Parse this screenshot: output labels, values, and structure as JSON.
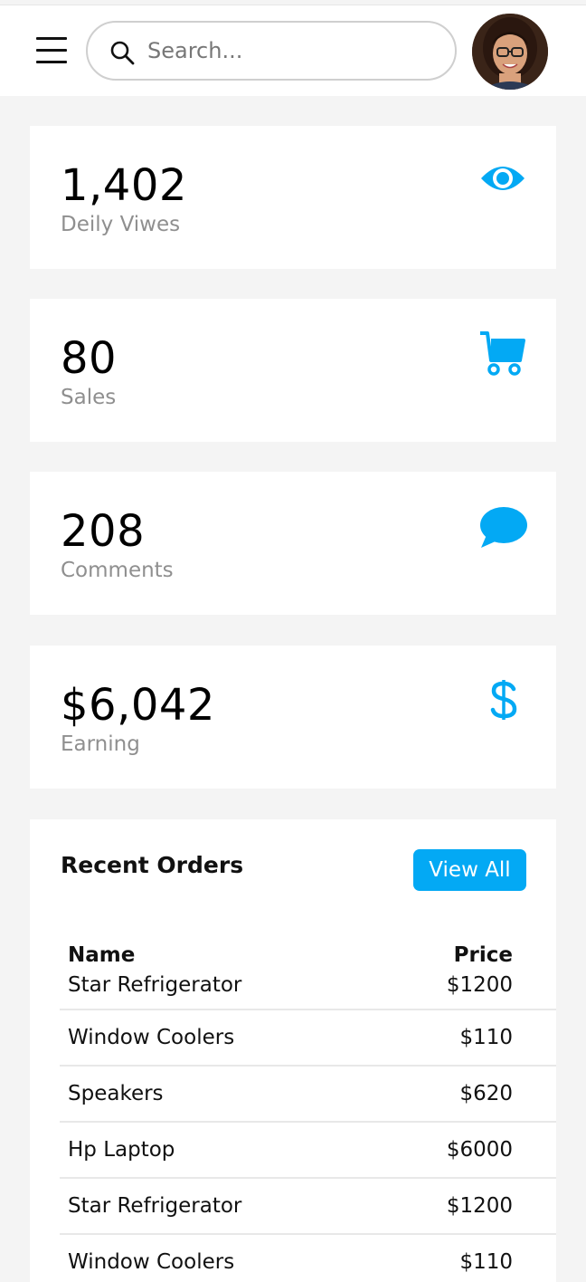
{
  "header": {
    "search_placeholder": "Search...",
    "menu_icon": "hamburger-icon",
    "search_icon": "search-icon"
  },
  "cards": [
    {
      "value": "1,402",
      "label": "Deily Viwes",
      "icon": "eye-icon"
    },
    {
      "value": "80",
      "label": "Sales",
      "icon": "cart-icon"
    },
    {
      "value": "208",
      "label": "Comments",
      "icon": "comment-icon"
    },
    {
      "value": "$6,042",
      "label": "Earning",
      "icon": "dollar-icon"
    }
  ],
  "orders": {
    "title": "Recent Orders",
    "view_all": "View All",
    "columns": {
      "name": "Name",
      "price": "Price"
    },
    "rows": [
      {
        "name": "Star Refrigerator",
        "price": "$1200"
      },
      {
        "name": "Window Coolers",
        "price": "$110"
      },
      {
        "name": "Speakers",
        "price": "$620"
      },
      {
        "name": "Hp Laptop",
        "price": "$6000"
      },
      {
        "name": "Star Refrigerator",
        "price": "$1200"
      },
      {
        "name": "Window Coolers",
        "price": "$110"
      }
    ]
  },
  "colors": {
    "accent": "#03a9f4",
    "muted": "#8f8f8f",
    "background": "#f4f4f4"
  }
}
